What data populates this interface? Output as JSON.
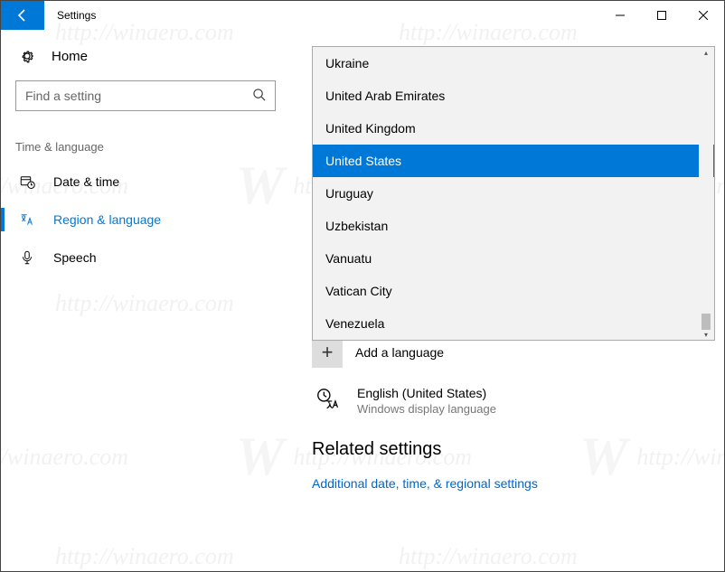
{
  "window": {
    "title": "Settings"
  },
  "sidebar": {
    "home": "Home",
    "search_placeholder": "Find a setting",
    "group": "Time & language",
    "items": [
      {
        "label": "Date & time"
      },
      {
        "label": "Region & language"
      },
      {
        "label": "Speech"
      }
    ]
  },
  "dropdown": {
    "items": [
      "Ukraine",
      "United Arab Emirates",
      "United Kingdom",
      "United States",
      "Uruguay",
      "Uzbekistan",
      "Vanuatu",
      "Vatican City",
      "Venezuela"
    ],
    "selected_index": 3
  },
  "add_language_label": "Add a language",
  "current_language": {
    "name": "English (United States)",
    "subtitle": "Windows display language"
  },
  "related": {
    "heading": "Related settings",
    "link": "Additional date, time, & regional settings"
  },
  "watermark_text": "http://winaero.com"
}
